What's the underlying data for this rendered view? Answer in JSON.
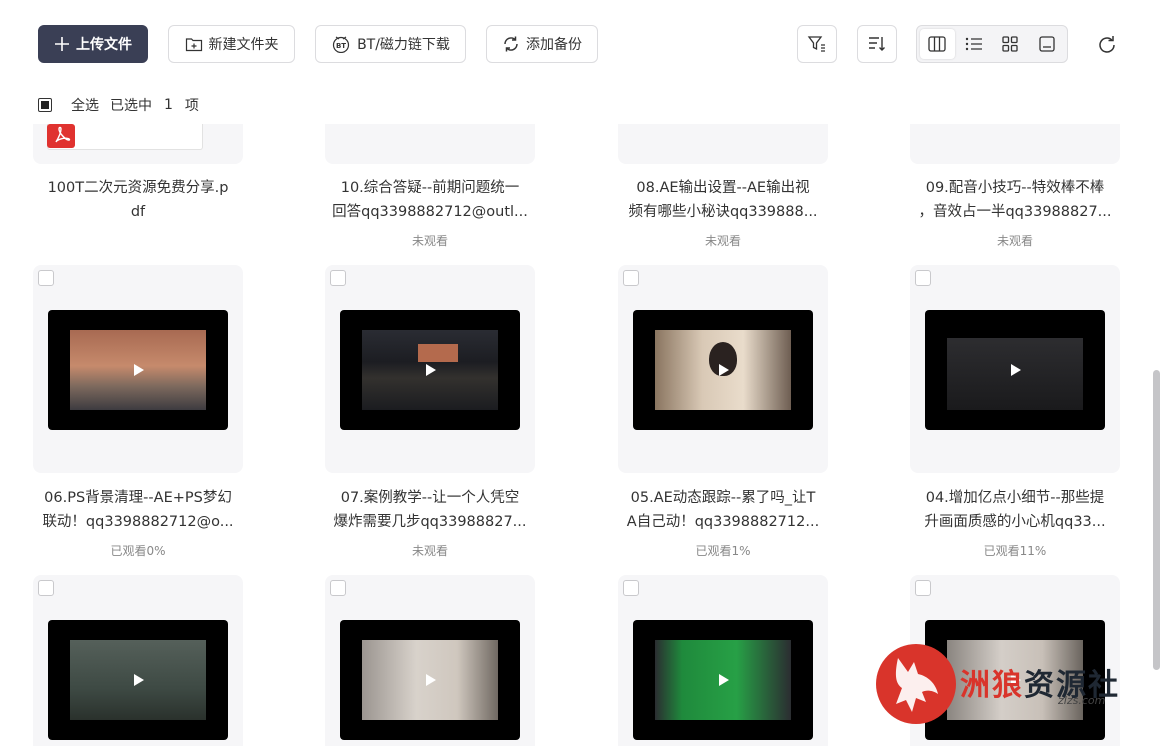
{
  "toolbar": {
    "upload_label": "上传文件",
    "new_folder_label": "新建文件夹",
    "bt_label": "BT/磁力链下载",
    "backup_label": "添加备份"
  },
  "selection": {
    "select_all_label": "全选",
    "selected_label": "已选中",
    "count": "1",
    "unit": "项"
  },
  "row1": [
    {
      "line1": "100T二次元资源免费分享.p",
      "line2": "df",
      "status": ""
    },
    {
      "line1": "10.综合答疑--前期问题统一",
      "line2": "回答qq3398882712@outl...",
      "status": "未观看"
    },
    {
      "line1": "08.AE输出设置--AE输出视",
      "line2": "频有哪些小秘诀qq339888...",
      "status": "未观看"
    },
    {
      "line1": "09.配音小技巧--特效棒不棒",
      "line2": "，音效占一半qq33988827...",
      "status": "未观看"
    }
  ],
  "row2": [
    {
      "line1": "06.PS背景清理--AE+PS梦幻",
      "line2": "联动！qq3398882712@o...",
      "status": "已观看0%"
    },
    {
      "line1": "07.案例教学--让一个人凭空",
      "line2": "爆炸需要几步qq33988827...",
      "status": "未观看"
    },
    {
      "line1": "05.AE动态跟踪--累了吗_让T",
      "line2": "A自己动！qq3398882712...",
      "status": "已观看1%"
    },
    {
      "line1": "04.增加亿点小细节--那些提",
      "line2": "升画面质感的小心机qq33...",
      "status": "已观看11%"
    }
  ],
  "watermark": {
    "part1": "洲",
    "part2": "狼",
    "part3": "资源社",
    "sub": "zlzs.com"
  },
  "colors": {
    "primary_button": "#3a3f55",
    "card_bg": "#f6f6f8",
    "watermark_red": "#d9342b"
  }
}
